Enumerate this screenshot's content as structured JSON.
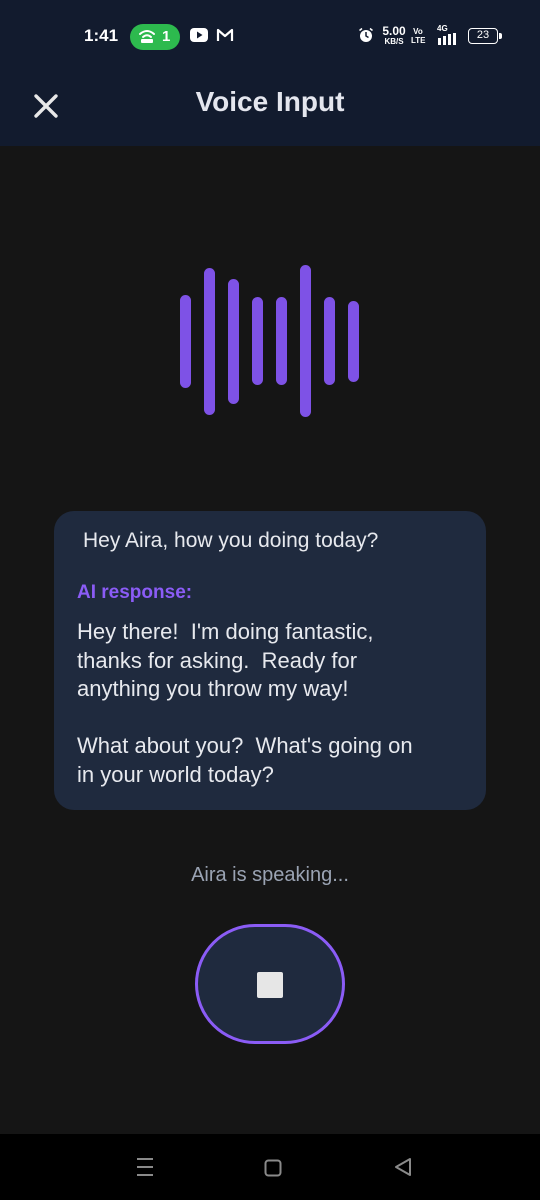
{
  "status_bar": {
    "time": "1:41",
    "hotspot_count": "1",
    "net_speed_value": "5.00",
    "net_speed_unit": "KB/S",
    "volte_top": "Vo",
    "volte_bottom": "LTE",
    "network_type": "4G",
    "battery_level": "23"
  },
  "app_bar": {
    "title": "Voice Input",
    "close_icon": "close-icon"
  },
  "visualizer": {
    "color": "#7e52e6",
    "levels": [
      0.61,
      0.97,
      0.82,
      0.58,
      0.58,
      1.0,
      0.58,
      0.53
    ]
  },
  "conversation": {
    "user_message": "Hey Aira, how you doing today?",
    "ai_label": "AI response:",
    "ai_response": "Hey there!  I'm doing fantastic,\nthanks for asking.  Ready for\nanything you throw my way!\n\nWhat about you?  What's going on\nin your world today?"
  },
  "status": {
    "text": "Aira is speaking..."
  },
  "controls": {
    "stop_icon": "stop-icon"
  },
  "colors": {
    "accent": "#8b5cf6",
    "background": "#151515",
    "header": "#121b2e",
    "card": "#1f2a3e"
  }
}
